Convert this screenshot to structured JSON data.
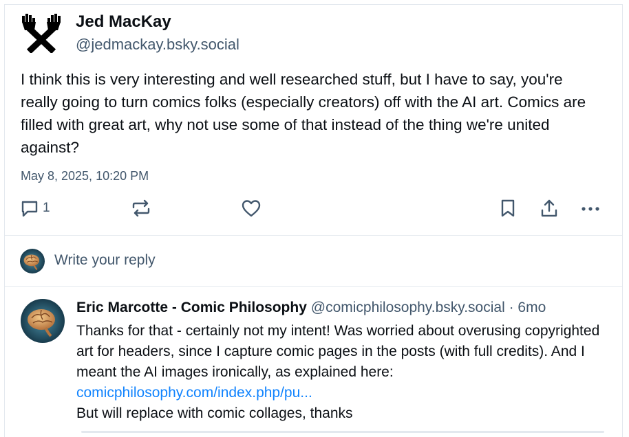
{
  "post": {
    "author_name": "Jed MacKay",
    "author_handle": "@jedmackay.bsky.social",
    "text": "I think this is very interesting and well researched stuff, but I have to say, you're really going to turn comics folks (especially creators) off with the AI art. Comics are filled with great art, why not use some of that instead of the thing we're united against?",
    "timestamp": "May 8, 2025, 10:20 PM",
    "avatar_icon": "crossed-hammers-icon",
    "actions": {
      "reply_icon": "reply-bubble-icon",
      "reply_count": "1",
      "repost_icon": "repost-icon",
      "like_icon": "heart-icon",
      "bookmark_icon": "bookmark-icon",
      "share_icon": "share-icon",
      "more_icon": "more-dots-icon"
    }
  },
  "composer": {
    "placeholder": "Write your reply",
    "avatar_icon": "brain-avatar-icon"
  },
  "reply": {
    "author_name": "Eric Marcotte - Comic Philosophy",
    "author_handle": "@comicphilosophy.bsky.social",
    "separator": " · ",
    "age": "6mo",
    "text_before_link": "Thanks for that - certainly not my intent! Was worried about overusing copyrighted art for headers, since I capture comic pages in the posts (with full credits). And I meant the AI images ironically, as explained here: ",
    "link_text": "comicphilosophy.com/index.php/pu...",
    "text_after_link": "But will replace with comic collages, thanks",
    "avatar_icon": "brain-avatar-icon"
  },
  "colors": {
    "text_primary": "#0b0f14",
    "text_secondary": "#42576c",
    "link": "#1083fe",
    "border": "#e3e8ee"
  }
}
